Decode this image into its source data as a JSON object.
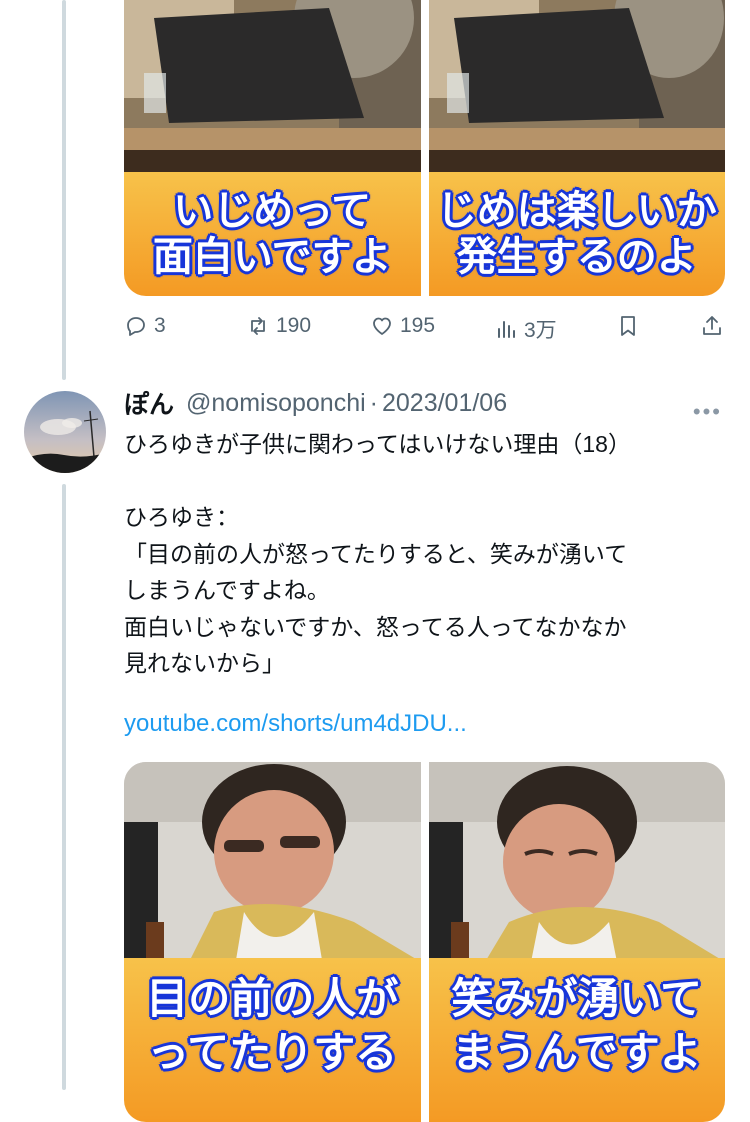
{
  "post1": {
    "thumbnails": [
      {
        "caption_lines": [
          "いじめって",
          "面白いですよ"
        ]
      },
      {
        "caption_lines": [
          "じめは楽しいか",
          "発生するのよ"
        ]
      }
    ],
    "actions": {
      "replies": "3",
      "reposts": "190",
      "likes": "195",
      "views": "3万"
    }
  },
  "post2": {
    "display_name": "ぽん",
    "handle": "@nomisoponchi",
    "separator": "·",
    "date": "2023/01/06",
    "text_lines": [
      "ひろゆきが子供に関わってはいけない理由（18）",
      "",
      "ひろゆき：",
      "「目の前の人が怒ってたりすると、笑みが湧いて",
      "しまうんですよね。",
      "面白いじゃないですか、怒ってる人ってなかなか",
      "見れないから」"
    ],
    "link": "youtube.com/shorts/um4dJDU...",
    "thumbnails": [
      {
        "caption_lines": [
          "目の前の人が",
          "ってたりする"
        ]
      },
      {
        "caption_lines": [
          "笑みが湧いて",
          "まうんですよ"
        ]
      }
    ]
  },
  "icons": {
    "reply": "reply-icon",
    "repost": "repost-icon",
    "like": "heart-icon",
    "views": "views-icon",
    "bookmark": "bookmark-icon",
    "share": "share-icon",
    "more": "more-icon"
  },
  "colors": {
    "link": "#1d9bf0",
    "secondary_text": "#536471",
    "caption_fill": "#f49a24",
    "caption_outline": "#1836d9"
  }
}
